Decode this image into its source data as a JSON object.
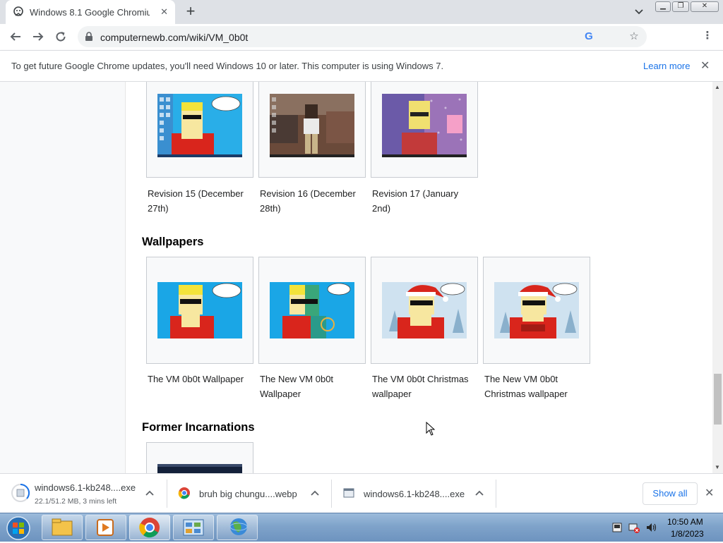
{
  "browser": {
    "tab_title": "Windows 8.1 Google Chromium",
    "url": "computernewb.com/wiki/VM_0b0t"
  },
  "infobar": {
    "message": "To get future Google Chrome updates, you'll need Windows 10 or later. This computer is using Windows 7.",
    "learn_more": "Learn more"
  },
  "gallery_revisions": [
    {
      "caption": "Revision 15 (December 27th)"
    },
    {
      "caption": "Revision 16 (December 28th)"
    },
    {
      "caption": "Revision 17 (January 2nd)"
    }
  ],
  "sections": {
    "wallpapers": "Wallpapers",
    "former": "Former Incarnations"
  },
  "gallery_wallpapers": [
    {
      "caption": "The VM 0b0t Wallpaper"
    },
    {
      "caption": "The New VM 0b0t Wallpaper"
    },
    {
      "caption": "The VM 0b0t Christmas wallpaper"
    },
    {
      "caption": "The New VM 0b0t Christmas wallpaper"
    }
  ],
  "downloads": [
    {
      "name": "windows6.1-kb248....exe",
      "status": "22.1/51.2 MB, 3 mins left"
    },
    {
      "name": "bruh big chungu....webp"
    },
    {
      "name": "windows6.1-kb248....exe"
    }
  ],
  "download_bar": {
    "show_all": "Show all"
  },
  "taskbar": {
    "time": "10:50 AM",
    "date": "1/8/2023"
  },
  "colors": {
    "accent": "#1a73e8",
    "tabstrip": "#dee1e6",
    "taskbar": "#7fa3ca"
  }
}
